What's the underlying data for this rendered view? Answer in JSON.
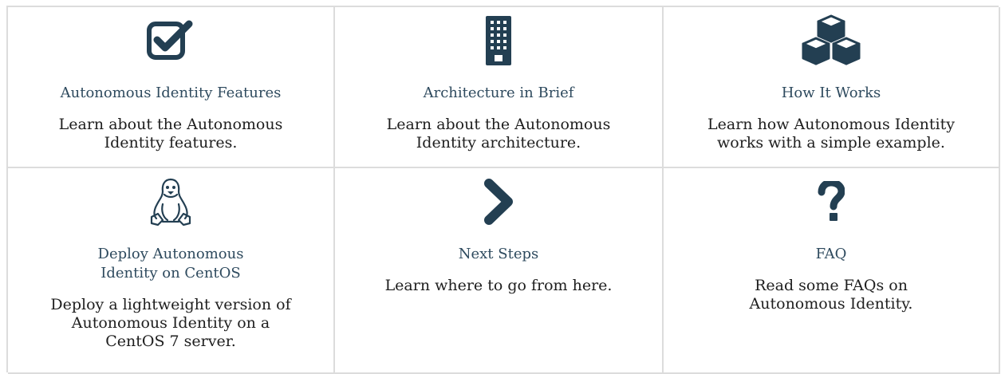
{
  "cards": [
    {
      "icon": "checkbox-icon",
      "title": "Autonomous Identity Features",
      "description": "Learn about the Autonomous Identity features."
    },
    {
      "icon": "building-icon",
      "title": "Architecture in Brief",
      "description": "Learn about the Autonomous Identity architecture."
    },
    {
      "icon": "cubes-icon",
      "title": "How It Works",
      "description": "Learn how Autonomous Identity works with a simple example."
    },
    {
      "icon": "linux-penguin-icon",
      "title": "Deploy Autonomous Identity on CentOS",
      "description": "Deploy a lightweight version of Autonomous Identity on a CentOS 7 server."
    },
    {
      "icon": "chevron-right-icon",
      "title": "Next Steps",
      "description": "Learn where to go from here."
    },
    {
      "icon": "question-mark-icon",
      "title": "FAQ",
      "description": "Read some FAQs on Autonomous Identity."
    }
  ],
  "colors": {
    "icon": "#233f52",
    "link": "#2e4a5e",
    "text": "#1e1e1e",
    "border": "#dcdcdc"
  }
}
